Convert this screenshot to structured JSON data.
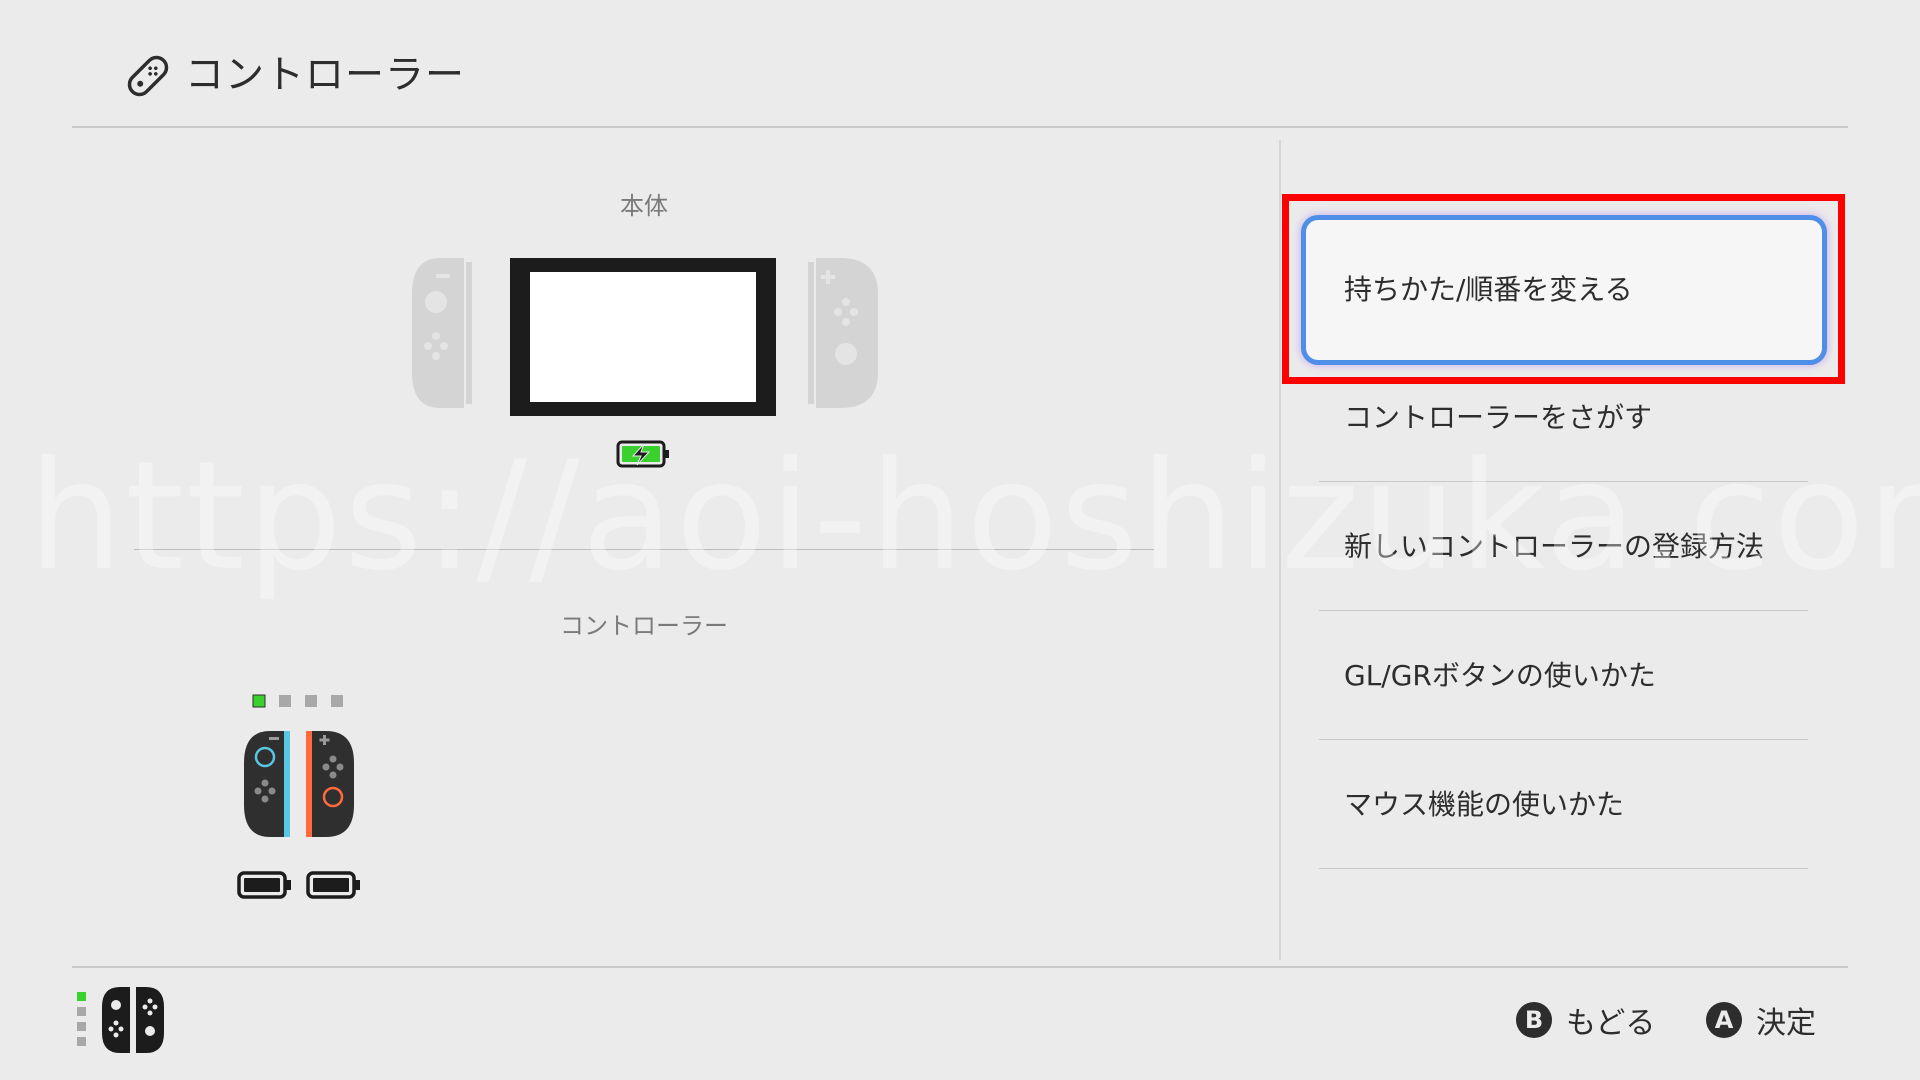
{
  "header": {
    "title": "コントローラー",
    "icon": "controller-icon"
  },
  "left": {
    "console_label": "本体",
    "controllers_label": "コントローラー",
    "console_battery": "charging",
    "player_leds": [
      "on",
      "off",
      "off",
      "off"
    ],
    "joycon_colors": {
      "left_accent": "#57c7e3",
      "right_accent": "#ff6b3d"
    }
  },
  "menu": {
    "selected_index": 0,
    "items": [
      {
        "label": "持ちかた/順番を変える"
      },
      {
        "label": "コントローラーをさがす"
      },
      {
        "label": "新しいコントローラーの登録方法"
      },
      {
        "label": "GL/GRボタンの使いかた"
      },
      {
        "label": "マウス機能の使いかた"
      }
    ]
  },
  "footer": {
    "back": {
      "key": "B",
      "label": "もどる"
    },
    "ok": {
      "key": "A",
      "label": "決定"
    }
  },
  "watermark": "https://aoi-hoshizuka.com/",
  "colors": {
    "background": "#ebebeb",
    "highlight": "#ff0000",
    "led_on": "#3ad12f",
    "selection": "#4f8fe8"
  }
}
